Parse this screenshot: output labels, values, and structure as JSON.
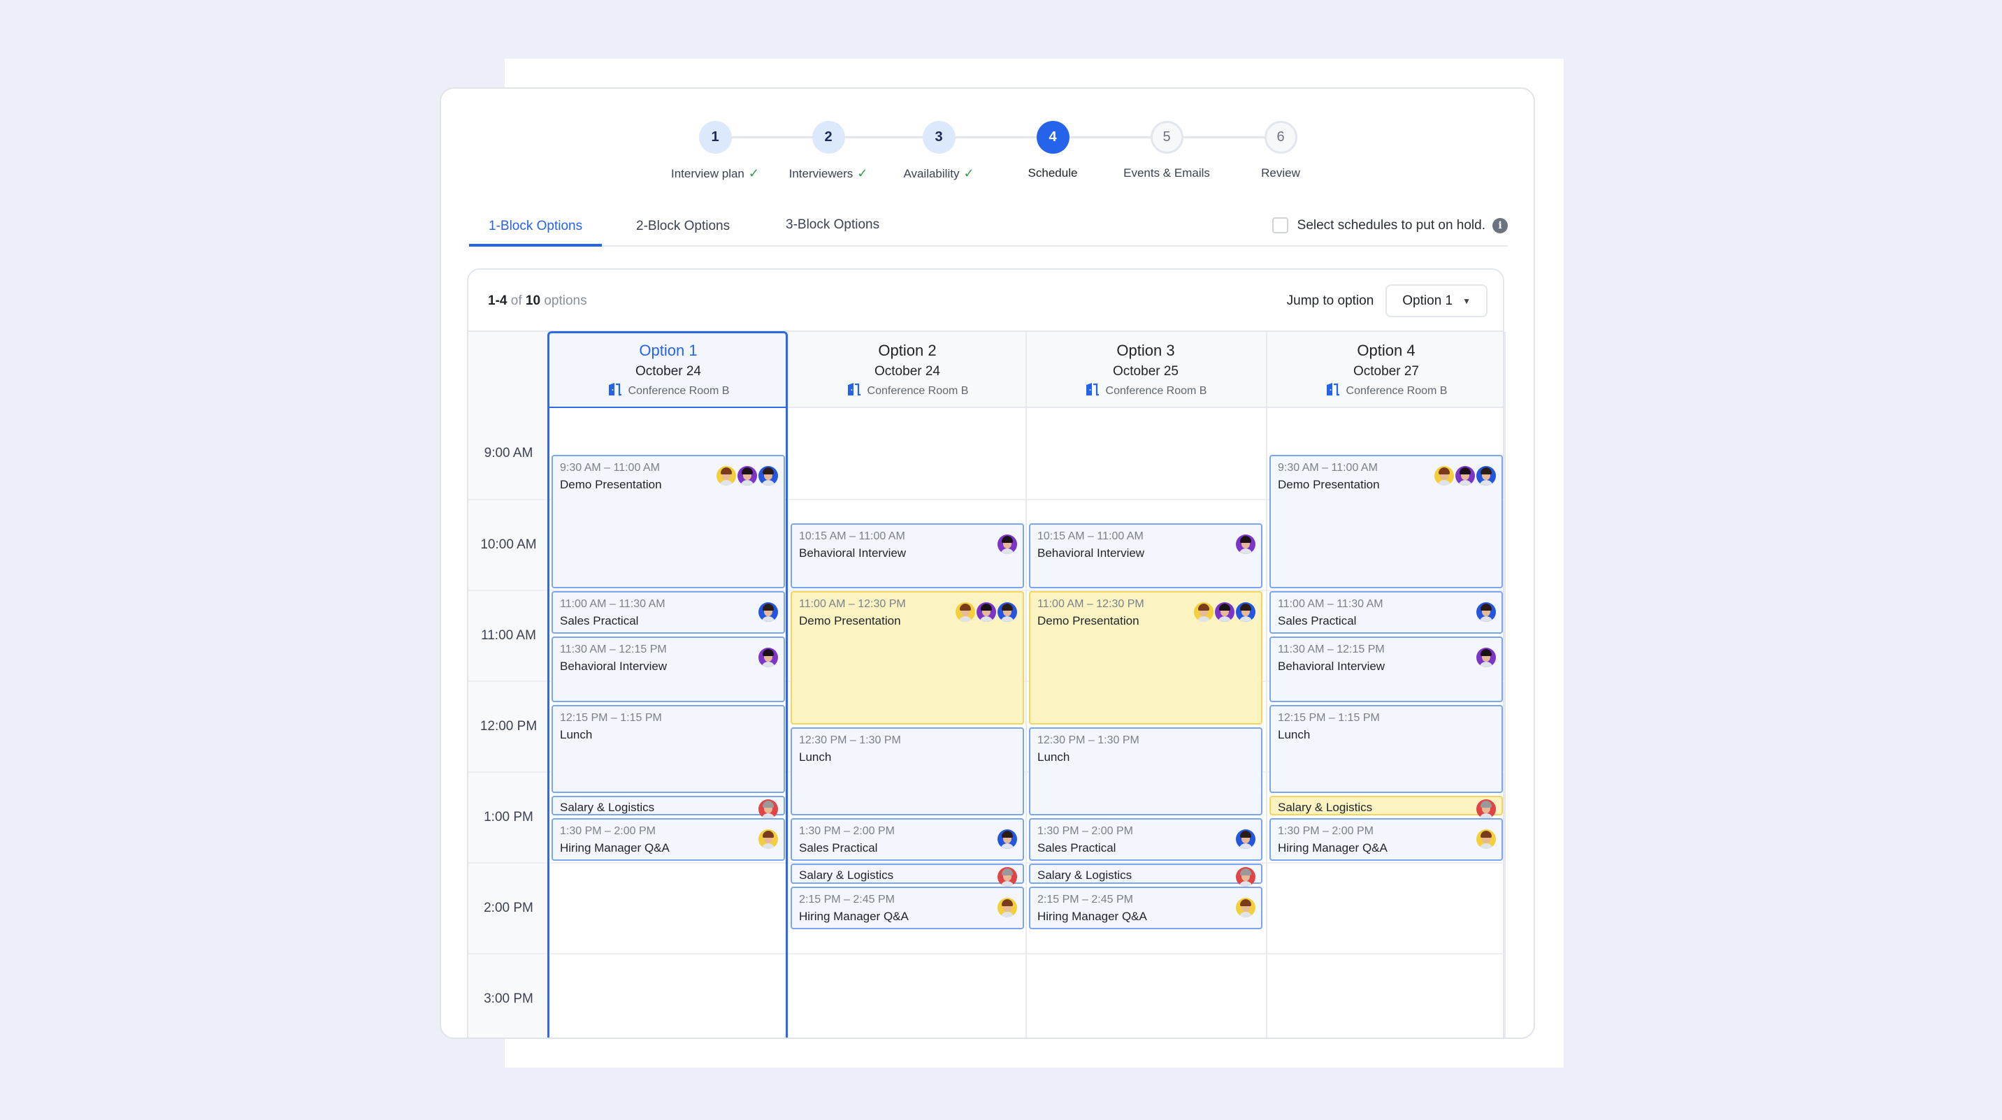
{
  "stepper": {
    "steps": [
      {
        "number": "1",
        "label": "Interview plan",
        "status": "done"
      },
      {
        "number": "2",
        "label": "Interviewers",
        "status": "done"
      },
      {
        "number": "3",
        "label": "Availability",
        "status": "done"
      },
      {
        "number": "4",
        "label": "Schedule",
        "status": "active"
      },
      {
        "number": "5",
        "label": "Events & Emails",
        "status": "todo"
      },
      {
        "number": "6",
        "label": "Review",
        "status": "todo"
      }
    ],
    "check_icon": "✓"
  },
  "tabs": [
    {
      "label": "1-Block Options",
      "active": true
    },
    {
      "label": "2-Block Options",
      "active": false
    },
    {
      "label": "3-Block Options",
      "active": false
    }
  ],
  "hold": {
    "label": "Select schedules to put on hold.",
    "checked": false,
    "info_icon": "i"
  },
  "options_summary": {
    "range": "1-4",
    "of": "of",
    "total": "10",
    "suffix": "options"
  },
  "jump": {
    "label": "Jump to option",
    "selected": "Option 1",
    "caret": "▼"
  },
  "hours": [
    "9:00 AM",
    "10:00 AM",
    "11:00 AM",
    "12:00 PM",
    "1:00 PM",
    "2:00 PM",
    "3:00 PM"
  ],
  "colors": {
    "accent": "#2563eb",
    "event_bg": "#f3f6fc",
    "event_border": "#7aa6ef",
    "highlight_bg": "#fcf3c2",
    "highlight_border": "#f6d55c"
  },
  "interviewers": {
    "yellow": {
      "bg": "#f3cf3e",
      "hair": "#7a3b1c"
    },
    "purple": {
      "bg": "#7b35c9",
      "hair": "#1a1216"
    },
    "blue": {
      "bg": "#2456e0",
      "hair": "#2b1d16"
    },
    "red": {
      "bg": "#e04444",
      "hair": "#9a9a9a"
    }
  },
  "options": [
    {
      "title": "Option 1",
      "date": "October 24",
      "room": "Conference Room B",
      "selected": true,
      "events": [
        {
          "start": 9.5,
          "end": 11,
          "time": "9:30 AM – 11:00 AM",
          "title": "Demo Presentation",
          "avatars": [
            "yellow",
            "purple",
            "blue"
          ],
          "highlight": false
        },
        {
          "start": 11,
          "end": 11.5,
          "time": "11:00 AM – 11:30 AM",
          "title": "Sales Practical",
          "avatars": [
            "blue"
          ],
          "highlight": false
        },
        {
          "start": 11.5,
          "end": 12.25,
          "time": "11:30 AM – 12:15 PM",
          "title": "Behavioral Interview",
          "avatars": [
            "purple"
          ],
          "highlight": false
        },
        {
          "start": 12.25,
          "end": 13.25,
          "time": "12:15 PM – 1:15 PM",
          "title": "Lunch",
          "avatars": [],
          "highlight": false
        },
        {
          "start": 13.25,
          "end": 13.5,
          "time": "",
          "title": "Salary & Logistics",
          "avatars": [
            "red"
          ],
          "highlight": false
        },
        {
          "start": 13.5,
          "end": 14,
          "time": "1:30 PM – 2:00 PM",
          "title": "Hiring Manager Q&A",
          "avatars": [
            "yellow"
          ],
          "highlight": false
        }
      ]
    },
    {
      "title": "Option 2",
      "date": "October 24",
      "room": "Conference Room B",
      "selected": false,
      "events": [
        {
          "start": 10.25,
          "end": 11,
          "time": "10:15 AM – 11:00 AM",
          "title": "Behavioral Interview",
          "avatars": [
            "purple"
          ],
          "highlight": false
        },
        {
          "start": 11,
          "end": 12.5,
          "time": "11:00 AM – 12:30 PM",
          "title": "Demo Presentation",
          "avatars": [
            "yellow",
            "purple",
            "blue"
          ],
          "highlight": true
        },
        {
          "start": 12.5,
          "end": 13.5,
          "time": "12:30 PM – 1:30 PM",
          "title": "Lunch",
          "avatars": [],
          "highlight": false
        },
        {
          "start": 13.5,
          "end": 14,
          "time": "1:30 PM – 2:00 PM",
          "title": "Sales Practical",
          "avatars": [
            "blue"
          ],
          "highlight": false
        },
        {
          "start": 14,
          "end": 14.25,
          "time": "",
          "title": "Salary & Logistics",
          "avatars": [
            "red"
          ],
          "highlight": false
        },
        {
          "start": 14.25,
          "end": 14.75,
          "time": "2:15 PM – 2:45 PM",
          "title": "Hiring Manager Q&A",
          "avatars": [
            "yellow"
          ],
          "highlight": false
        }
      ]
    },
    {
      "title": "Option 3",
      "date": "October 25",
      "room": "Conference Room B",
      "selected": false,
      "events": [
        {
          "start": 10.25,
          "end": 11,
          "time": "10:15 AM – 11:00 AM",
          "title": "Behavioral Interview",
          "avatars": [
            "purple"
          ],
          "highlight": false
        },
        {
          "start": 11,
          "end": 12.5,
          "time": "11:00 AM – 12:30 PM",
          "title": "Demo Presentation",
          "avatars": [
            "yellow",
            "purple",
            "blue"
          ],
          "highlight": true
        },
        {
          "start": 12.5,
          "end": 13.5,
          "time": "12:30 PM – 1:30 PM",
          "title": "Lunch",
          "avatars": [],
          "highlight": false
        },
        {
          "start": 13.5,
          "end": 14,
          "time": "1:30 PM – 2:00 PM",
          "title": "Sales Practical",
          "avatars": [
            "blue"
          ],
          "highlight": false
        },
        {
          "start": 14,
          "end": 14.25,
          "time": "",
          "title": "Salary & Logistics",
          "avatars": [
            "red"
          ],
          "highlight": false
        },
        {
          "start": 14.25,
          "end": 14.75,
          "time": "2:15 PM – 2:45 PM",
          "title": "Hiring Manager Q&A",
          "avatars": [
            "yellow"
          ],
          "highlight": false
        }
      ]
    },
    {
      "title": "Option 4",
      "date": "October 27",
      "room": "Conference Room B",
      "selected": false,
      "events": [
        {
          "start": 9.5,
          "end": 11,
          "time": "9:30 AM – 11:00 AM",
          "title": "Demo Presentation",
          "avatars": [
            "yellow",
            "purple",
            "blue"
          ],
          "highlight": false
        },
        {
          "start": 11,
          "end": 11.5,
          "time": "11:00 AM – 11:30 AM",
          "title": "Sales Practical",
          "avatars": [
            "blue"
          ],
          "highlight": false
        },
        {
          "start": 11.5,
          "end": 12.25,
          "time": "11:30 AM – 12:15 PM",
          "title": "Behavioral Interview",
          "avatars": [
            "purple"
          ],
          "highlight": false
        },
        {
          "start": 12.25,
          "end": 13.25,
          "time": "12:15 PM – 1:15 PM",
          "title": "Lunch",
          "avatars": [],
          "highlight": false
        },
        {
          "start": 13.25,
          "end": 13.5,
          "time": "",
          "title": "Salary & Logistics",
          "avatars": [
            "red"
          ],
          "highlight": true
        },
        {
          "start": 13.5,
          "end": 14,
          "time": "1:30 PM – 2:00 PM",
          "title": "Hiring Manager Q&A",
          "avatars": [
            "yellow"
          ],
          "highlight": false
        }
      ]
    }
  ]
}
